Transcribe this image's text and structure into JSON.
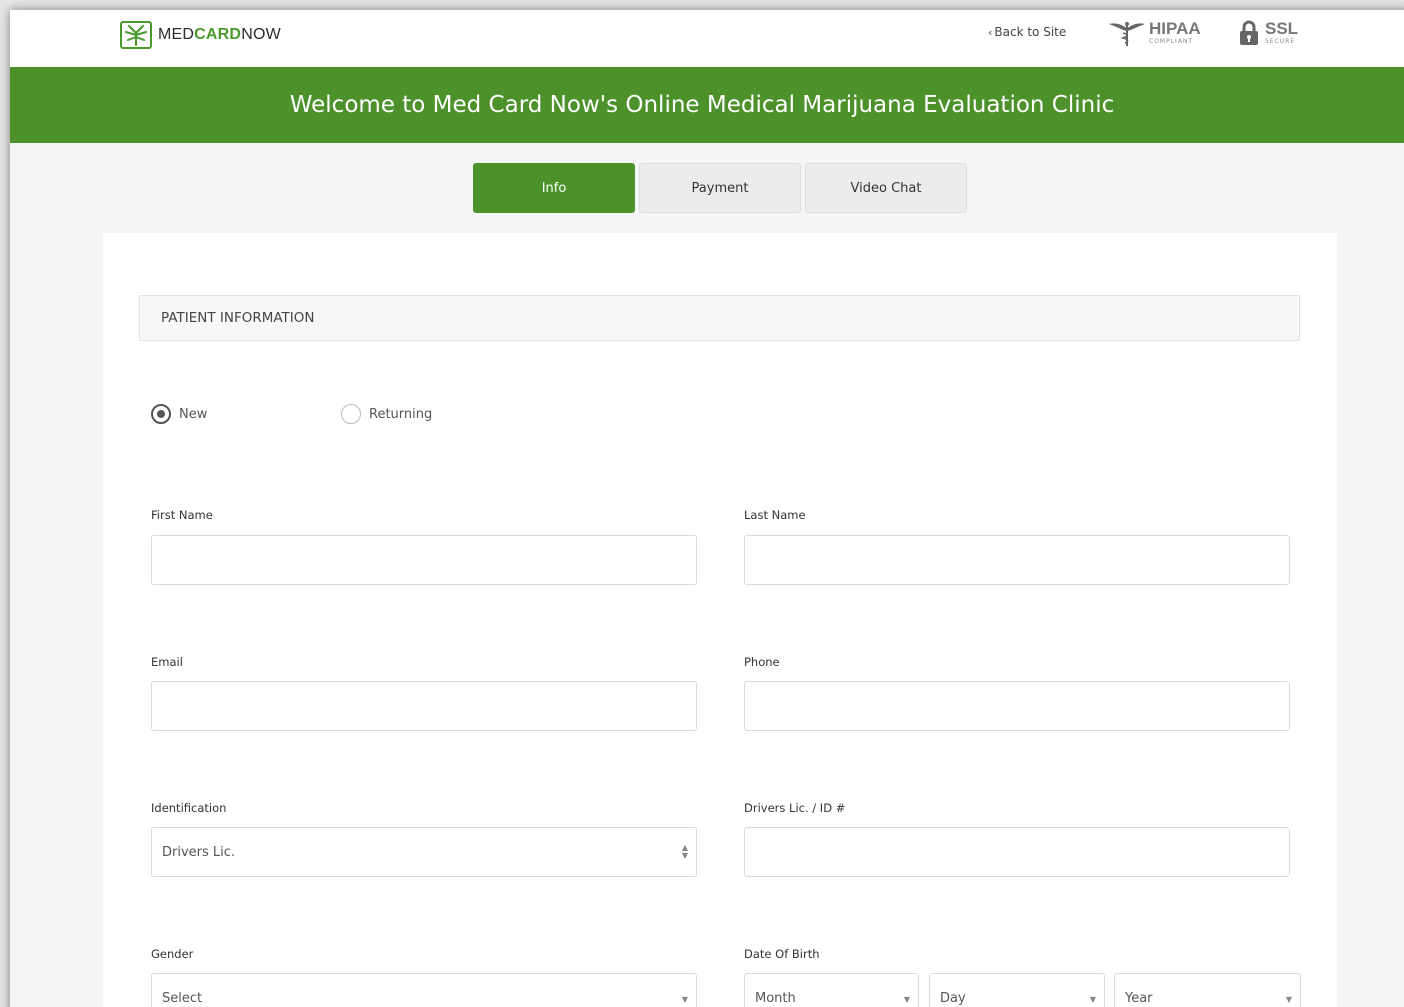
{
  "header": {
    "logo": {
      "part1": "MED",
      "part2": "CARD",
      "part3": "NOW"
    },
    "back_link": "Back to Site",
    "back_chevron": "‹",
    "hipaa": {
      "main": "HIPAA",
      "sub": "COMPLIANT"
    },
    "ssl": {
      "main": "SSL",
      "sub": "SECURE"
    }
  },
  "banner": {
    "title": "Welcome to Med Card Now's Online Medical Marijuana Evaluation Clinic"
  },
  "tabs": [
    {
      "label": "Info",
      "active": true
    },
    {
      "label": "Payment",
      "active": false
    },
    {
      "label": "Video Chat",
      "active": false
    }
  ],
  "form": {
    "section_title": "PATIENT INFORMATION",
    "patient_type": {
      "options": [
        "New",
        "Returning"
      ],
      "selected": "New"
    },
    "first_name": {
      "label": "First Name",
      "value": ""
    },
    "last_name": {
      "label": "Last Name",
      "value": ""
    },
    "email": {
      "label": "Email",
      "value": ""
    },
    "phone": {
      "label": "Phone",
      "value": ""
    },
    "identification": {
      "label": "Identification",
      "value": "Drivers Lic."
    },
    "id_number": {
      "label": "Drivers Lic. / ID #",
      "value": ""
    },
    "gender": {
      "label": "Gender",
      "value": "Select"
    },
    "dob": {
      "label": "Date Of Birth",
      "month": "Month",
      "day": "Day",
      "year": "Year"
    }
  },
  "colors": {
    "brand_green": "#4d912b",
    "accent_green": "#4a9a2b"
  },
  "icons": {
    "logo": "cannabis-leaf-logo-icon",
    "hipaa": "caduceus-icon",
    "ssl": "padlock-icon"
  }
}
